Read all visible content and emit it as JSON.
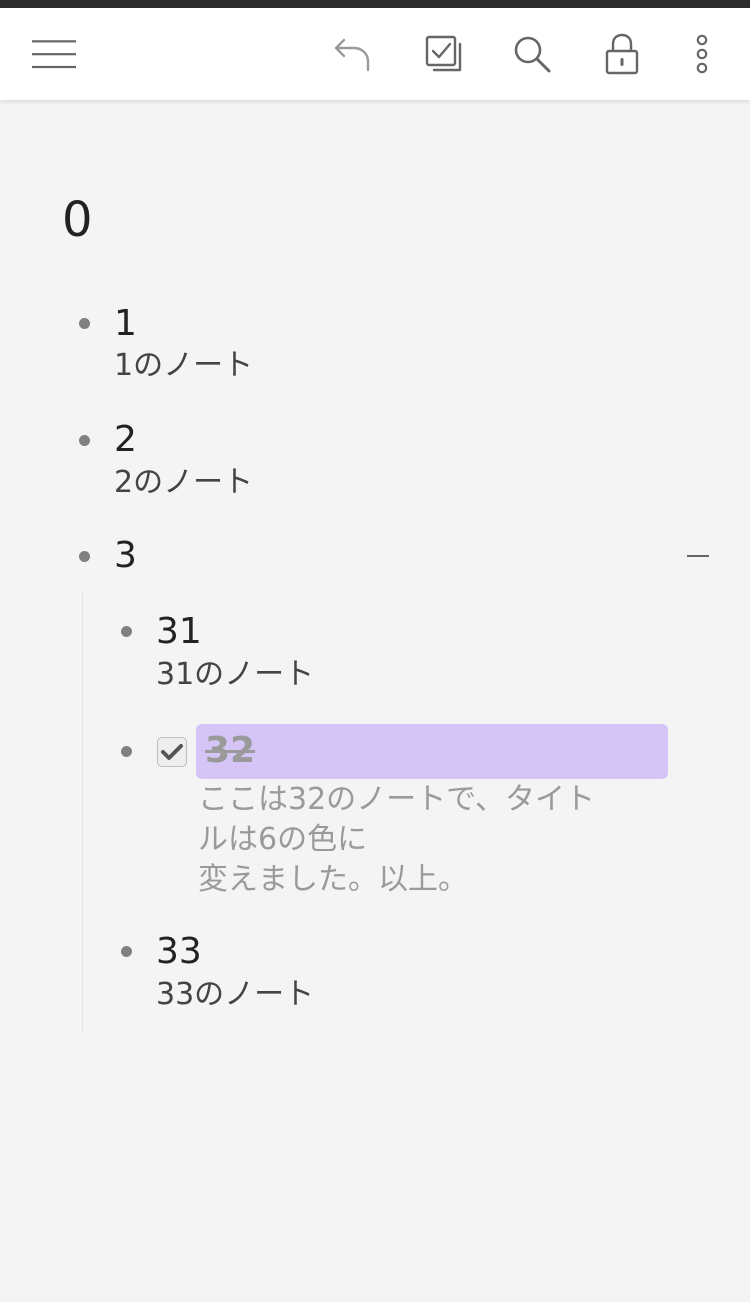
{
  "toolbar": {
    "icons": [
      "menu-icon",
      "undo-icon",
      "checklist-icon",
      "search-icon",
      "lock-icon",
      "more-vertical-icon"
    ]
  },
  "outline": {
    "root_title": "0",
    "items": [
      {
        "title": "1",
        "note": "1のノート"
      },
      {
        "title": "2",
        "note": "2のノート"
      },
      {
        "title": "3",
        "collapse_symbol": "−",
        "children": [
          {
            "title": "31",
            "note": "31のノート"
          },
          {
            "title": "32",
            "checked": true,
            "completed": true,
            "highlight_color": "#d5c5f6",
            "note_lines": [
              "ここは32のノートで、タイト",
              "ルは6の色に",
              "変えました。以上。"
            ]
          },
          {
            "title": "33",
            "note": "33のノート"
          }
        ]
      }
    ]
  },
  "colors": {
    "background": "#f4f4f4",
    "toolbar": "#ffffff",
    "highlight": "#d5c5f6",
    "completed_text": "#9a9a9a",
    "bullet": "#808080"
  }
}
